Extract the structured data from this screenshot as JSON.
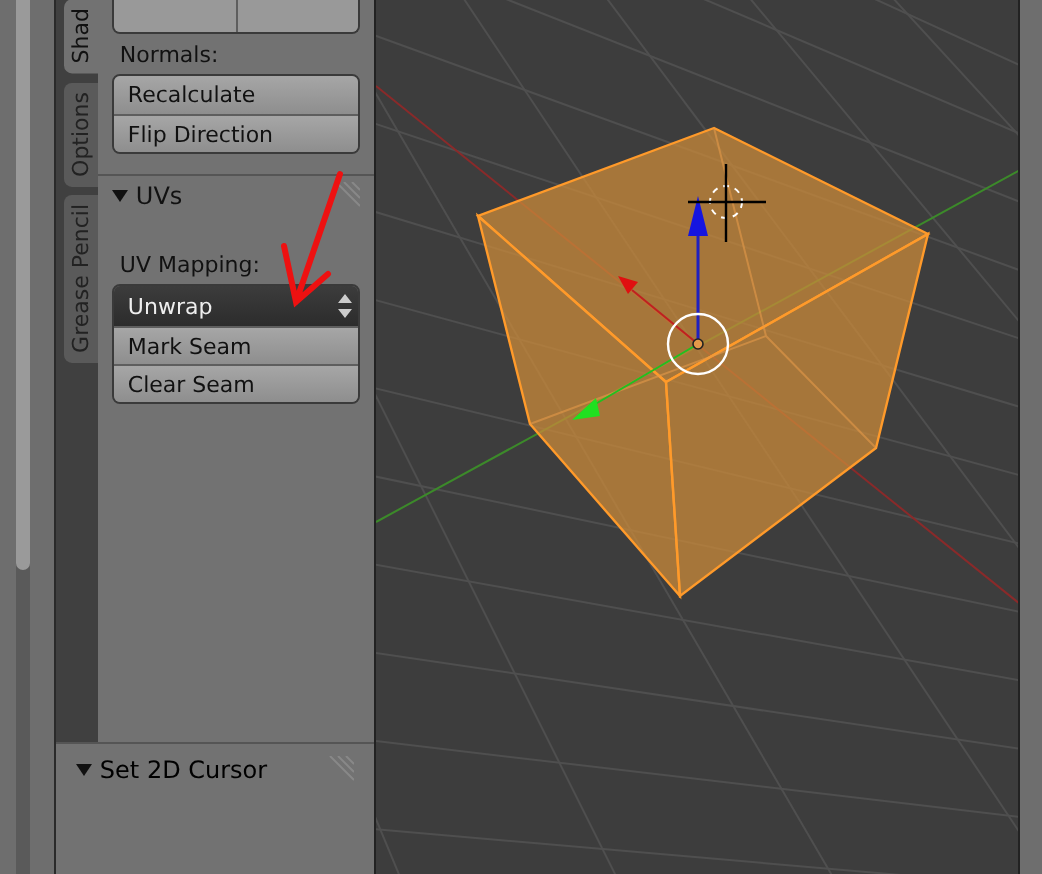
{
  "side_tabs": [
    {
      "label": "Shad",
      "selected": true
    },
    {
      "label": "Options",
      "selected": false
    },
    {
      "label": "Grease Pencil",
      "selected": false
    }
  ],
  "tool_panel": {
    "normals_label": "Normals:",
    "normal_buttons": [
      "Recalculate",
      "Flip Direction"
    ],
    "uvs_panel": {
      "title": "UVs",
      "expanded": true,
      "uv_mapping_label": "UV Mapping:",
      "uv_mapping_value": "Unwrap",
      "seam_buttons": [
        "Mark Seam",
        "Clear Seam"
      ]
    }
  },
  "cursor_panel": {
    "title": "Set 2D Cursor",
    "expanded": true
  }
}
